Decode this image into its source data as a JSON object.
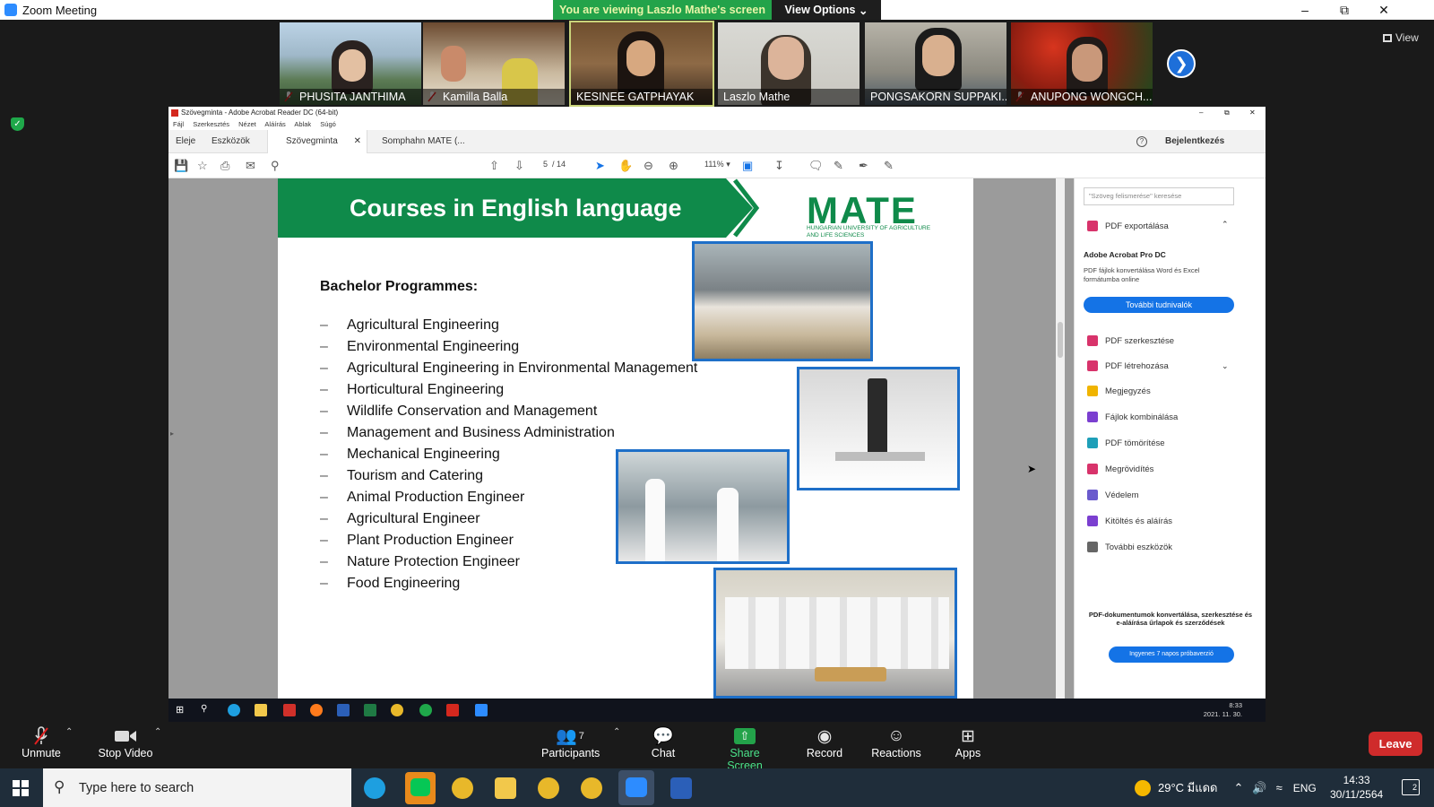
{
  "zoom": {
    "window_title": "Zoom Meeting",
    "viewing_banner": "You are viewing Laszlo Mathe's screen",
    "view_options": "View Options",
    "view_button": "View",
    "participants": [
      {
        "name": "PHUSITA JANTHIMA",
        "muted": true
      },
      {
        "name": "Kamilla Balla",
        "muted": true
      },
      {
        "name": "KESINEE GATPHAYAK",
        "muted": false
      },
      {
        "name": "Laszlo Mathe",
        "muted": false
      },
      {
        "name": "PONGSAKORN SUPPAKI...",
        "muted": false
      },
      {
        "name": "ANUPONG WONGCH...",
        "muted": true
      }
    ],
    "controls": {
      "unmute": "Unmute",
      "stop_video": "Stop Video",
      "participants": "Participants",
      "participants_count": "7",
      "chat": "Chat",
      "share_screen": "Share Screen",
      "record": "Record",
      "reactions": "Reactions",
      "apps": "Apps",
      "leave": "Leave"
    }
  },
  "acrobat": {
    "title": "Szövegminta - Adobe Acrobat Reader DC (64-bit)",
    "menu": [
      "Fájl",
      "Szerkesztés",
      "Nézet",
      "Aláírás",
      "Ablak",
      "Súgó"
    ],
    "tabs": {
      "home": "Eleje",
      "tools": "Eszközök",
      "doc1": "Szövegminta",
      "doc2": "Somphahn MATE (..."
    },
    "signin": "Bejelentkezés",
    "page_current": "5",
    "page_total": "/ 14",
    "zoom": "111%",
    "right_panel": {
      "search_placeholder": "\"Szöveg felismerése\" keresése",
      "export_pdf": "PDF exportálása",
      "pro_title": "Adobe Acrobat Pro DC",
      "pro_desc": "PDF fájlok konvertálása Word és Excel formátumba online",
      "learn_more": "További tudnivalók",
      "tools": [
        "PDF szerkesztése",
        "PDF létrehozása",
        "Megjegyzés",
        "Fájlok kombinálása",
        "PDF tömörítése",
        "Megrövidítés",
        "Védelem",
        "Kitöltés és aláírás",
        "További eszközök"
      ],
      "tool_colors": [
        "#d8336b",
        "#d8336b",
        "#f0b400",
        "#7b3fd0",
        "#1e9fb8",
        "#d8336b",
        "#6a5acd",
        "#7b3fd0",
        "#666666"
      ],
      "promo_text_1": "PDF-dokumentumok konvertálása, szerkesztése és",
      "promo_text_2": "e-aláírása űrlapok és szerződések",
      "trial": "Ingyenes 7 napos próbaverzió"
    }
  },
  "slide": {
    "title": "Courses in English language",
    "logo": "MATE",
    "logo_sub": "HUNGARIAN UNIVERSITY OF AGRICULTURE AND LIFE SCIENCES",
    "heading": "Bachelor Programmes:",
    "dash": "–",
    "programmes": [
      "Agricultural Engineering",
      "Environmental Engineering",
      "Agricultural Engineering in Environmental Management",
      "Horticultural Engineering",
      "Wildlife Conservation and Management",
      "Management and Business Administration",
      "Mechanical Engineering",
      "Tourism and Catering",
      "Animal Production Engineer",
      "Agricultural Engineer",
      "Plant Production Engineer",
      "Nature Protection Engineer",
      "Food Engineering"
    ]
  },
  "shared_taskbar": {
    "time": "8:33",
    "date": "2021. 11. 30."
  },
  "windows": {
    "search_placeholder": "Type here to search",
    "weather": "29°C มีแดด",
    "lang": "ENG",
    "time": "14:33",
    "date": "30/11/2564",
    "notifications": "2"
  },
  "colors": {
    "zoom_green": "#23a34a",
    "mate_green": "#0f8a4a",
    "acrobat_blue": "#1473e6",
    "leave_red": "#cf2b2b"
  }
}
